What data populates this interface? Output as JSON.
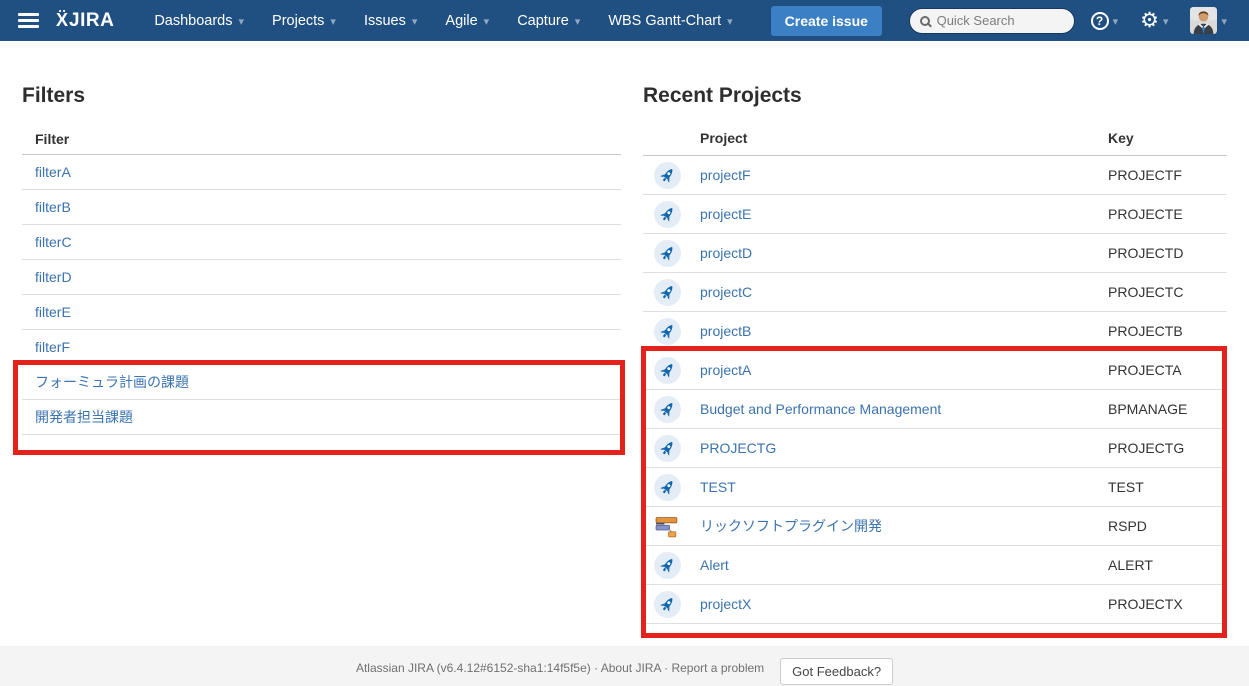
{
  "navbar": {
    "logo": {
      "mark": "Ẍ",
      "text": "JIRA"
    },
    "menu": [
      {
        "label": "Dashboards"
      },
      {
        "label": "Projects"
      },
      {
        "label": "Issues"
      },
      {
        "label": "Agile"
      },
      {
        "label": "Capture"
      },
      {
        "label": "WBS Gantt-Chart"
      }
    ],
    "create_issue_label": "Create issue",
    "search": {
      "placeholder": "Quick Search"
    },
    "help_glyph": "?"
  },
  "filters": {
    "title": "Filters",
    "column_header": "Filter",
    "items": [
      "filterA",
      "filterB",
      "filterC",
      "filterD",
      "filterE",
      "filterF",
      "フォーミュラ計画の課題",
      "開発者担当課題"
    ]
  },
  "recent_projects": {
    "title": "Recent Projects",
    "columns": {
      "project": "Project",
      "key": "Key"
    },
    "rows": [
      {
        "name": "projectF",
        "key": "PROJECTF",
        "icon": "rocket-icon"
      },
      {
        "name": "projectE",
        "key": "PROJECTE",
        "icon": "rocket-icon"
      },
      {
        "name": "projectD",
        "key": "PROJECTD",
        "icon": "rocket-icon"
      },
      {
        "name": "projectC",
        "key": "PROJECTC",
        "icon": "rocket-icon"
      },
      {
        "name": "projectB",
        "key": "PROJECTB",
        "icon": "rocket-icon"
      },
      {
        "name": "projectA",
        "key": "PROJECTA",
        "icon": "rocket-icon"
      },
      {
        "name": "Budget and Performance Management",
        "key": "BPMANAGE",
        "icon": "rocket-icon"
      },
      {
        "name": "PROJECTG",
        "key": "PROJECTG",
        "icon": "rocket-icon"
      },
      {
        "name": "TEST",
        "key": "TEST",
        "icon": "rocket-icon"
      },
      {
        "name": "リックソフトプラグイン開発",
        "key": "RSPD",
        "icon": "gantt-chart-icon"
      },
      {
        "name": "Alert",
        "key": "ALERT",
        "icon": "rocket-icon"
      },
      {
        "name": "projectX",
        "key": "PROJECTX",
        "icon": "rocket-icon"
      }
    ]
  },
  "footer": {
    "info_text": "Atlassian JIRA (v6.4.12#6152-sha1:14f5f5e) · About JIRA · Report a problem",
    "feedback_button_label": "Got Feedback?"
  },
  "annotations": {
    "highlight_color": "#e4211a",
    "boxes": [
      {
        "target": "filters-japanese-rows"
      },
      {
        "target": "recent-projects-lower-rows"
      }
    ]
  },
  "colors": {
    "header_bg": "#205081",
    "create_button": "#3b7fc4",
    "link": "#3b73af"
  }
}
